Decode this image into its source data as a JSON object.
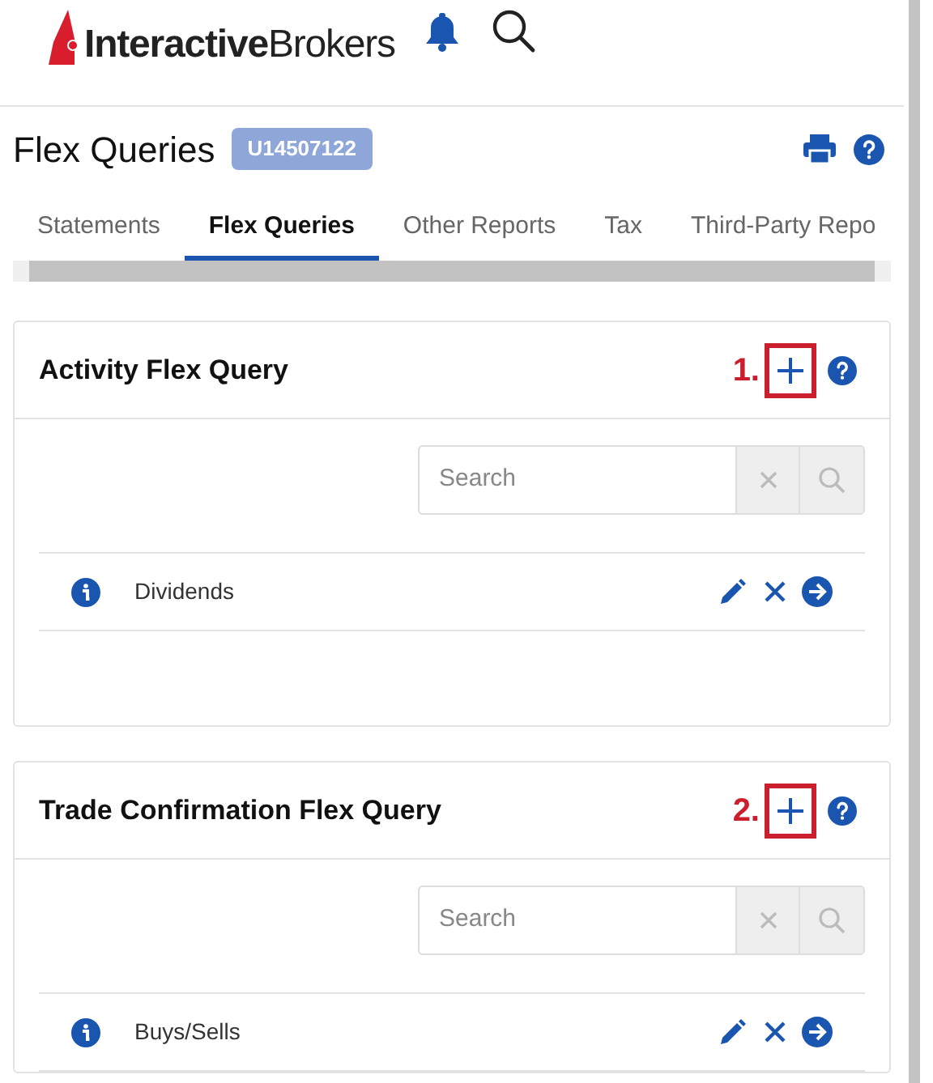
{
  "header": {
    "logo_text": "**Interactive**Brokers"
  },
  "page": {
    "title": "Flex Queries",
    "account_badge": "U14507122"
  },
  "tabs": [
    {
      "label": "Statements",
      "selected": false
    },
    {
      "label": "Flex Queries",
      "selected": true
    },
    {
      "label": "Other Reports",
      "selected": false
    },
    {
      "label": "Tax",
      "selected": false
    },
    {
      "label": "Third-Party Repo",
      "selected": false
    }
  ],
  "cards": [
    {
      "title": "Activity Flex Query",
      "annotation": "1.",
      "search": {
        "placeholder": "Search"
      },
      "queries": [
        {
          "name": "Dividends"
        }
      ]
    },
    {
      "title": "Trade Confirmation Flex Query",
      "annotation": "2.",
      "search": {
        "placeholder": "Search"
      },
      "queries": [
        {
          "name": "Buys/Sells"
        }
      ]
    }
  ]
}
